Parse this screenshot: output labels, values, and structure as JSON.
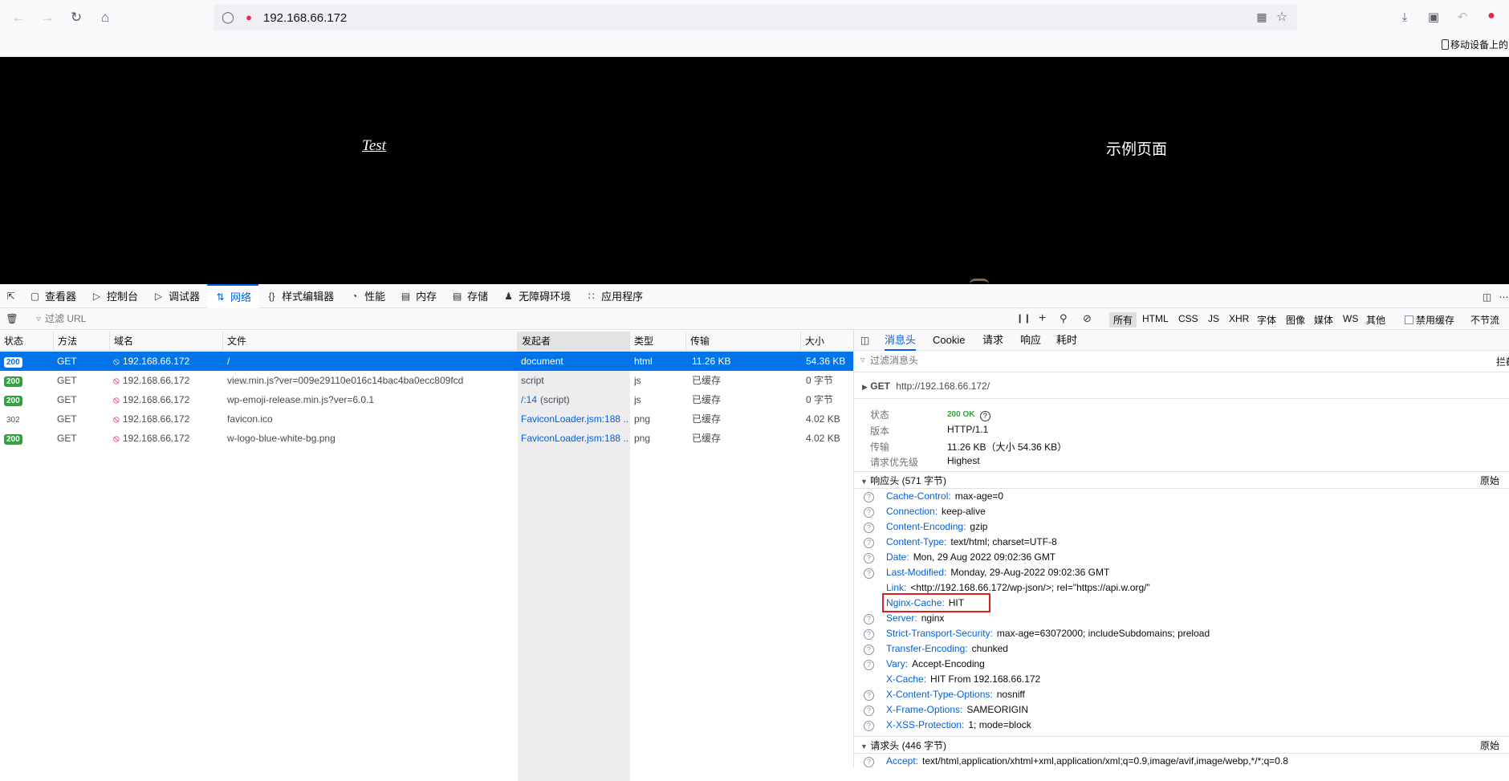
{
  "browser": {
    "url": "192.168.66.172",
    "mobile_label": "移动设备上的"
  },
  "page": {
    "link_text": "Test",
    "title": "示例页面"
  },
  "devtools": {
    "tabs": [
      {
        "label": "查看器",
        "icon": "inspector-icon"
      },
      {
        "label": "控制台",
        "icon": "console-icon"
      },
      {
        "label": "调试器",
        "icon": "debugger-icon"
      },
      {
        "label": "网络",
        "icon": "network-icon",
        "active": true
      },
      {
        "label": "样式编辑器",
        "icon": "style-editor-icon"
      },
      {
        "label": "性能",
        "icon": "performance-icon"
      },
      {
        "label": "内存",
        "icon": "memory-icon"
      },
      {
        "label": "存储",
        "icon": "storage-icon"
      },
      {
        "label": "无障碍环境",
        "icon": "accessibility-icon"
      },
      {
        "label": "应用程序",
        "icon": "application-icon"
      }
    ],
    "filter_placeholder": "过滤 URL",
    "type_filters": [
      "所有",
      "HTML",
      "CSS",
      "JS",
      "XHR",
      "字体",
      "图像",
      "媒体",
      "WS",
      "其他"
    ],
    "disable_cache": "禁用缓存",
    "throttle": "不节流"
  },
  "table": {
    "columns": [
      "状态",
      "方法",
      "域名",
      "文件",
      "发起者",
      "类型",
      "传输",
      "大小"
    ],
    "rows": [
      {
        "status": "200",
        "method": "GET",
        "domain": "192.168.66.172",
        "file": "/",
        "initiator": "document",
        "initiator_extra": "",
        "type": "html",
        "transfer": "11.26 KB",
        "size": "54.36 KB"
      },
      {
        "status": "200",
        "method": "GET",
        "domain": "192.168.66.172",
        "file": "view.min.js?ver=009e29110e016c14bac4ba0ecc809fcd",
        "initiator": "script",
        "initiator_extra": "",
        "type": "js",
        "transfer": "已缓存",
        "size": "0 字节"
      },
      {
        "status": "200",
        "method": "GET",
        "domain": "192.168.66.172",
        "file": "wp-emoji-release.min.js?ver=6.0.1",
        "initiator": "/:14",
        "initiator_extra": "(script)",
        "type": "js",
        "transfer": "已缓存",
        "size": "0 字节"
      },
      {
        "status": "302",
        "method": "GET",
        "domain": "192.168.66.172",
        "file": "favicon.ico",
        "initiator": "FaviconLoader.jsm:188 ...",
        "initiator_extra": "",
        "type": "png",
        "transfer": "已缓存",
        "size": "4.02 KB"
      },
      {
        "status": "200",
        "method": "GET",
        "domain": "192.168.66.172",
        "file": "w-logo-blue-white-bg.png",
        "initiator": "FaviconLoader.jsm:188 ...",
        "initiator_extra": "",
        "type": "png",
        "transfer": "已缓存",
        "size": "4.02 KB"
      }
    ]
  },
  "side": {
    "tabs": [
      "消息头",
      "Cookie",
      "请求",
      "响应",
      "耗时"
    ],
    "filter_placeholder": "过滤消息头",
    "block_label": "拦截",
    "request_line": {
      "method": "GET",
      "url": "http://192.168.66.172/"
    },
    "summary": [
      {
        "label": "状态",
        "value": "200 OK"
      },
      {
        "label": "版本",
        "value": "HTTP/1.1"
      },
      {
        "label": "传输",
        "value": "11.26 KB（大小 54.36 KB）"
      },
      {
        "label": "请求优先级",
        "value": "Highest"
      }
    ],
    "response_section": "响应头 (571 字节)",
    "raw_label": "原始",
    "response_headers": [
      {
        "name": "Cache-Control:",
        "value": "max-age=0",
        "help": true
      },
      {
        "name": "Connection:",
        "value": "keep-alive",
        "help": true
      },
      {
        "name": "Content-Encoding:",
        "value": "gzip",
        "help": true
      },
      {
        "name": "Content-Type:",
        "value": "text/html; charset=UTF-8",
        "help": true
      },
      {
        "name": "Date:",
        "value": "Mon, 29 Aug 2022 09:02:36 GMT",
        "help": true
      },
      {
        "name": "Last-Modified:",
        "value": "Monday, 29-Aug-2022 09:02:36 GMT",
        "help": true
      },
      {
        "name": "Link:",
        "value": "<http://192.168.66.172/wp-json/>; rel=\"https://api.w.org/\"",
        "help": false
      },
      {
        "name": "Nginx-Cache:",
        "value": "HIT",
        "help": false,
        "highlight": true
      },
      {
        "name": "Server:",
        "value": "nginx",
        "help": true
      },
      {
        "name": "Strict-Transport-Security:",
        "value": "max-age=63072000; includeSubdomains; preload",
        "help": true
      },
      {
        "name": "Transfer-Encoding:",
        "value": "chunked",
        "help": true
      },
      {
        "name": "Vary:",
        "value": "Accept-Encoding",
        "help": true
      },
      {
        "name": "X-Cache:",
        "value": "HIT From 192.168.66.172",
        "help": false
      },
      {
        "name": "X-Content-Type-Options:",
        "value": "nosniff",
        "help": true
      },
      {
        "name": "X-Frame-Options:",
        "value": "SAMEORIGIN",
        "help": true
      },
      {
        "name": "X-XSS-Protection:",
        "value": "1; mode=block",
        "help": true
      }
    ],
    "request_section": "请求头 (446 字节)",
    "request_headers": [
      {
        "name": "Accept:",
        "value": "text/html,application/xhtml+xml,application/xml;q=0.9,image/avif,image/webp,*/*;q=0.8",
        "help": true
      }
    ]
  },
  "colors": {
    "accent": "#0060df",
    "ok": "#31a33e",
    "selected_row": "#0074e8",
    "highlight_box": "#e02020"
  }
}
